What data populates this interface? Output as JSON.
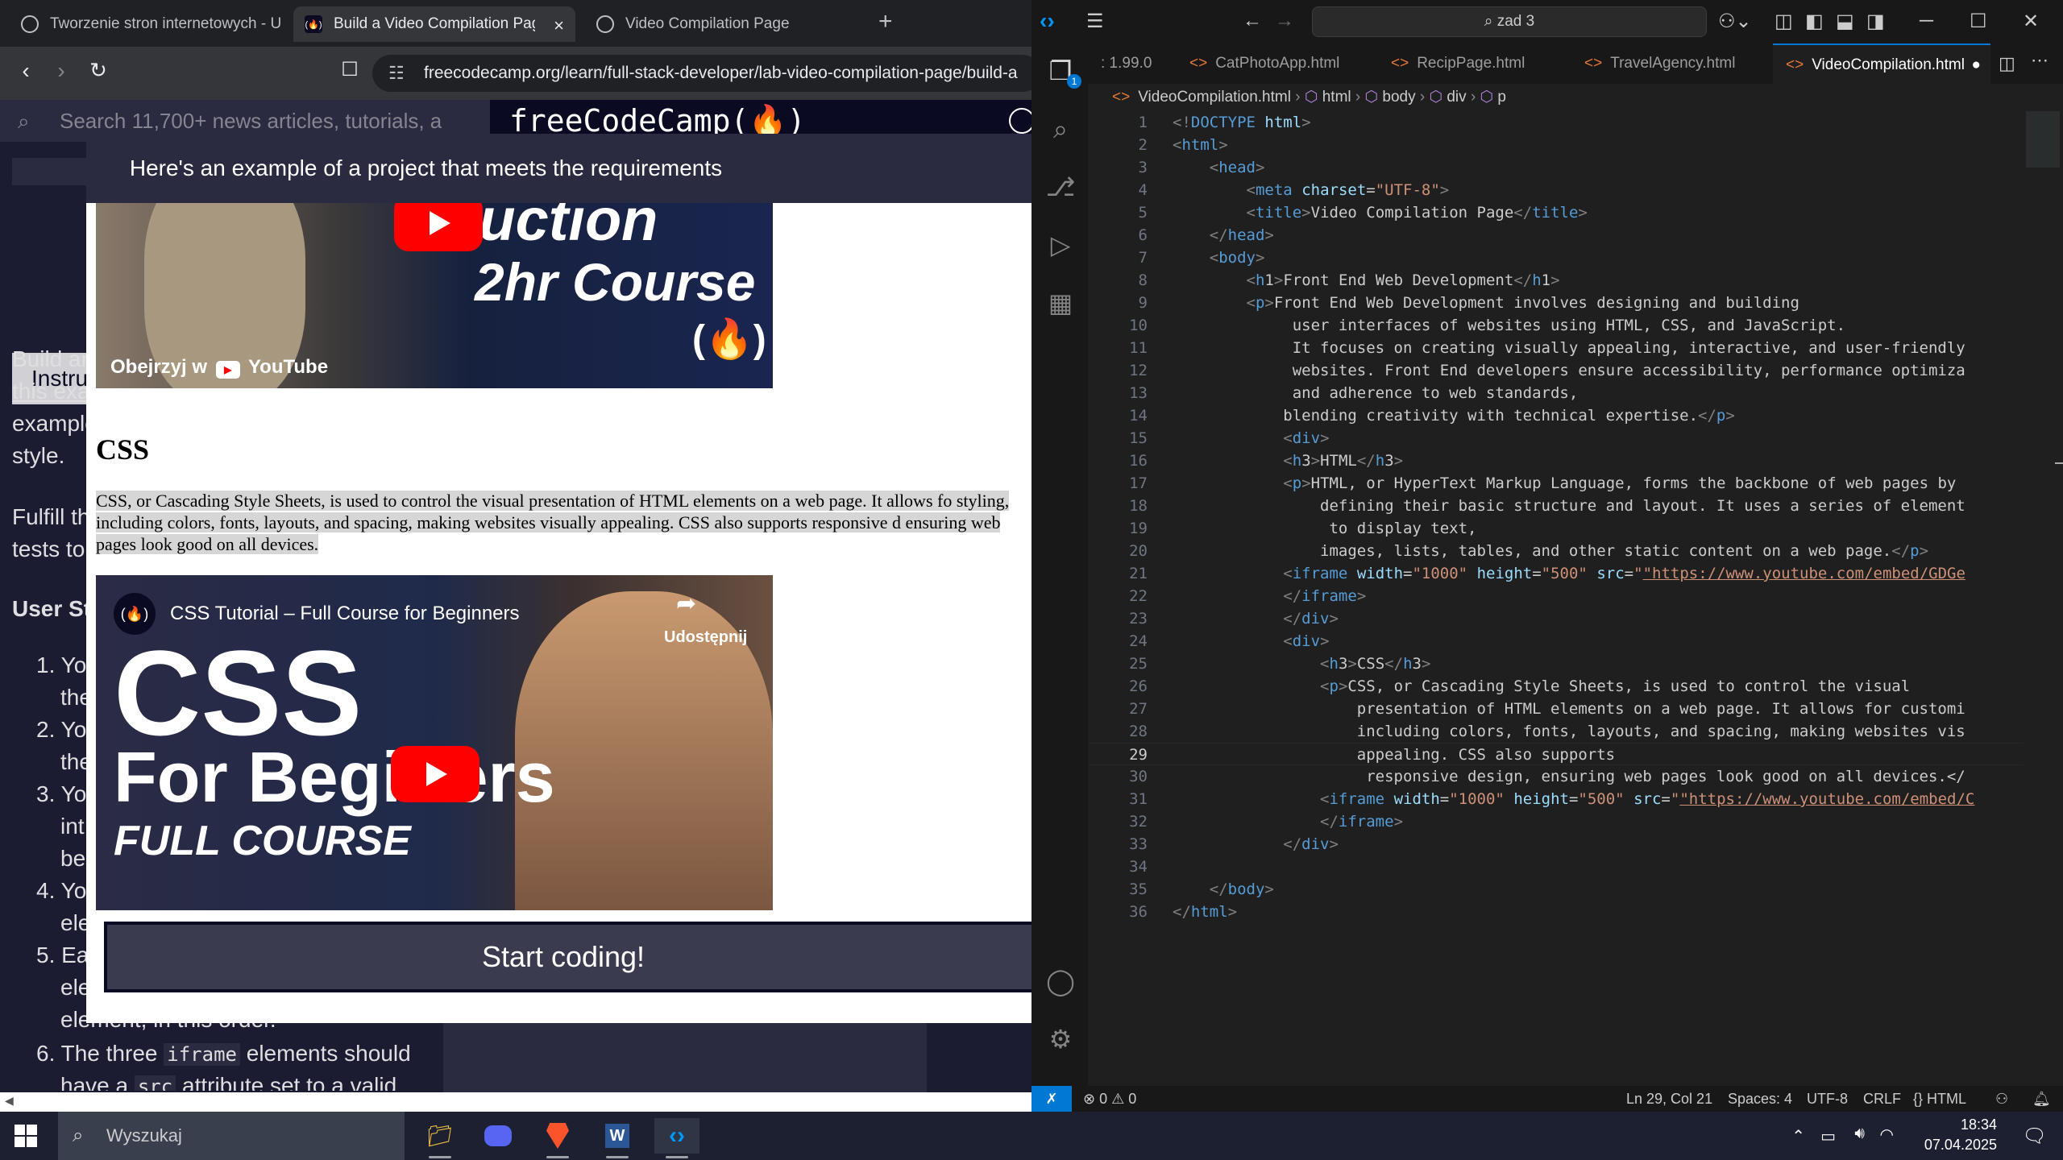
{
  "browser": {
    "tabs": [
      {
        "title": "Tworzenie stron internetowych - Un"
      },
      {
        "title": "Build a Video Compilation Page"
      },
      {
        "title": "Video Compilation Page"
      }
    ],
    "new_tab": "+",
    "url": "freecodecamp.org/learn/full-stack-developer/lab-video-compilation-page/build-a",
    "fcc_search_placeholder": "Search 11,700+ news articles, tutorials, a",
    "fcc_logo": "freeCodeCamp(🔥)"
  },
  "lesson": {
    "instructions_tab": "Instru",
    "lines": [
      "Build ar",
      "this exa",
      "example",
      "style.",
      "Fulfill th",
      "tests to",
      "User St"
    ],
    "list": [
      "1. Yo",
      "the",
      "2. Yo",
      "the",
      "3. Yo",
      "int",
      "be",
      "4. Yo",
      "ele",
      "5. Ea",
      "ele",
      "element, in this order.",
      "6. The three",
      "iframe",
      "elements should",
      "have a",
      "src",
      "attribute set to a valid"
    ]
  },
  "modal": {
    "header": "Here's an example of a project that meets the requirements",
    "video1": {
      "line1": "oduction",
      "line2": "2hr Course",
      "watch_on": "Obejrzyj w",
      "youtube": "YouTube"
    },
    "section_heading": "CSS",
    "paragraph": "CSS, or Cascading Style Sheets, is used to control the visual presentation of HTML elements on a web page. It allows fo styling, including colors, fonts, layouts, and spacing, making websites visually appealing. CSS also supports responsive d ensuring web pages look good on all devices.",
    "video2": {
      "title": "CSS Tutorial – Full Course for Beginners",
      "share": "Udostępnij",
      "big1": "CSS",
      "big2": "For Begir  ers",
      "big3": "FULL COURSE"
    },
    "start_button": "Start coding!"
  },
  "vscode": {
    "search": "zad 3",
    "tabs": [
      {
        "label": ": 1.99.0"
      },
      {
        "label": "CatPhotoApp.html"
      },
      {
        "label": "RecipPage.html"
      },
      {
        "label": "TravelAgency.html"
      },
      {
        "label": "VideoCompilation.html"
      }
    ],
    "breadcrumb": [
      "VideoCompilation.html",
      "html",
      "body",
      "div",
      "p"
    ],
    "cursor_line": 29,
    "code_lines": [
      "<!DOCTYPE html>",
      "<html>",
      "    <head>",
      "        <meta charset=\"UTF-8\">",
      "        <title>Video Compilation Page</title>",
      "    </head>",
      "    <body>",
      "        <h1>Front End Web Development</h1>",
      "        <p>Front End Web Development involves designing and building",
      "             user interfaces of websites using HTML, CSS, and JavaScript.",
      "             It focuses on creating visually appealing, interactive, and user-friendly",
      "             websites. Front End developers ensure accessibility, performance optimiza",
      "             and adherence to web standards,",
      "            blending creativity with technical expertise.</p>",
      "            <div>",
      "            <h3>HTML</h3>",
      "            <p>HTML, or HyperText Markup Language, forms the backbone of web pages by",
      "                defining their basic structure and layout. It uses a series of element",
      "                 to display text,",
      "                images, lists, tables, and other static content on a web page.</p>",
      "            <iframe width=\"1000\" height=\"500\" src=\"https://www.youtube.com/embed/GDGe",
      "            </iframe>",
      "            </div>",
      "            <div>",
      "                <h3>CSS</h3>",
      "                <p>CSS, or Cascading Style Sheets, is used to control the visual",
      "                    presentation of HTML elements on a web page. It allows for customi",
      "                    including colors, fonts, layouts, and spacing, making websites vis",
      "                    appealing. CSS also supports",
      "                     responsive design, ensuring web pages look good on all devices.</",
      "                <iframe width=\"1000\" height=\"500\" src=\"https://www.youtube.com/embed/C",
      "                </iframe>",
      "            </div>",
      "",
      "    </body>",
      "</html>"
    ],
    "status": {
      "errors": "0",
      "warnings": "0",
      "position": "Ln 29, Col 21",
      "spaces": "Spaces: 4",
      "encoding": "UTF-8",
      "eol": "CRLF",
      "language": "HTML"
    }
  },
  "taskbar": {
    "search": "Wyszukaj",
    "time": "18:34",
    "date": "07.04.2025"
  }
}
